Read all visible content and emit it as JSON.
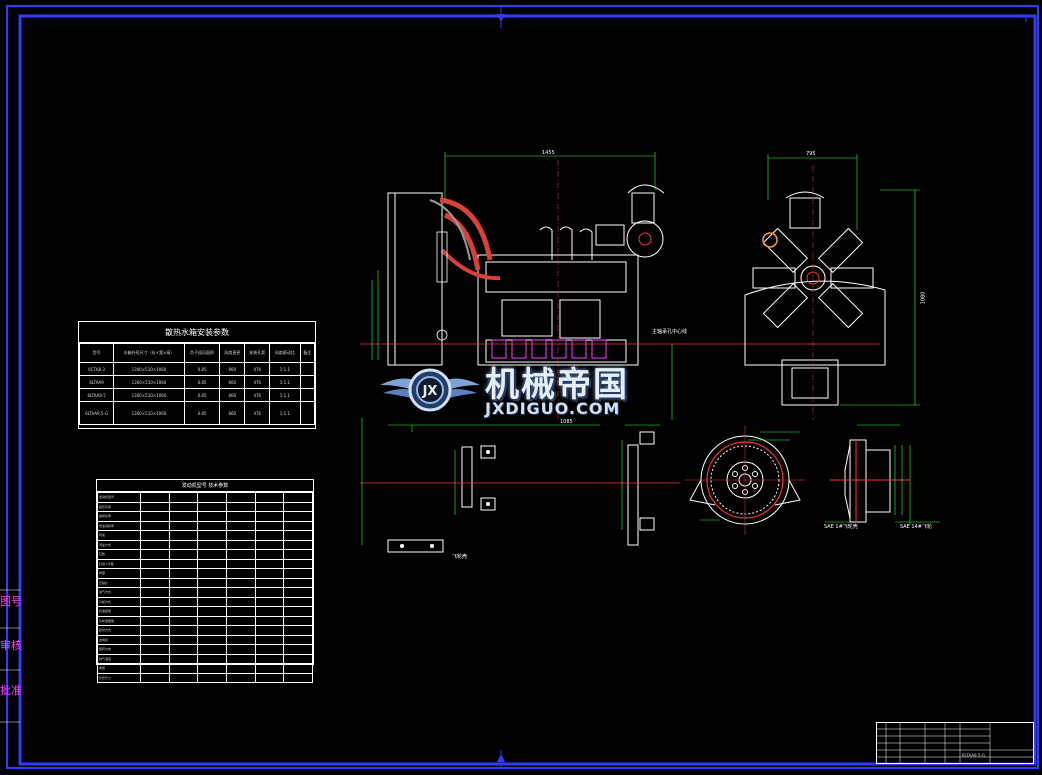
{
  "install_table": {
    "title": "散热水箱安装参数",
    "headers": [
      "型号",
      "水箱外形尺寸（长×宽×高）",
      "芯子迎风面积",
      "风扇直径",
      "安装孔距",
      "风扇驱动比",
      "备注"
    ],
    "rows": [
      [
        "6CTA8.3",
        "1300×510×1060",
        "0.85",
        "660",
        "476",
        "1:1.1",
        ""
      ],
      [
        "6LTAA9",
        "1300×510×1060",
        "0.85",
        "660",
        "476",
        "1:1.1",
        ""
      ],
      [
        "6LTAA9.5",
        "1300×510×1060",
        "0.85",
        "660",
        "476",
        "1:1.1",
        ""
      ],
      [
        "6LTAA9.5-G",
        "1300×510×1060",
        "0.85",
        "660",
        "476",
        "1:1.1",
        ""
      ]
    ]
  },
  "spec_table": {
    "title": "发动机型号 技术参数",
    "rows": [
      "发动机型号",
      "额定功率",
      "备用功率",
      "燃油消耗率",
      "转速",
      "调速方式",
      "缸数",
      "缸径×行程",
      "排量",
      "压缩比",
      "进气方式",
      "冷却方式",
      "机油容量",
      "冷却液容量",
      "起动方式",
      "发电机",
      "旋转方向",
      "排气温度",
      "重量",
      "外形尺寸"
    ]
  },
  "side_labels": [
    "图号",
    "审核",
    "批准"
  ],
  "watermark": {
    "main": "机械帝国",
    "sub": "JXDIGUO.COM",
    "emblem": "JX"
  },
  "dims": {
    "side_length": "1455",
    "front_width": "795",
    "height": "1080",
    "bottom_span": "1085",
    "crank_center": "主轴承孔中心线",
    "flywheel_note": "飞轮壳",
    "sae_left": "SAE 1#飞轮壳",
    "sae_right": "SAE 14#飞轮"
  },
  "title_block_code": "6LTAA9.5-G"
}
